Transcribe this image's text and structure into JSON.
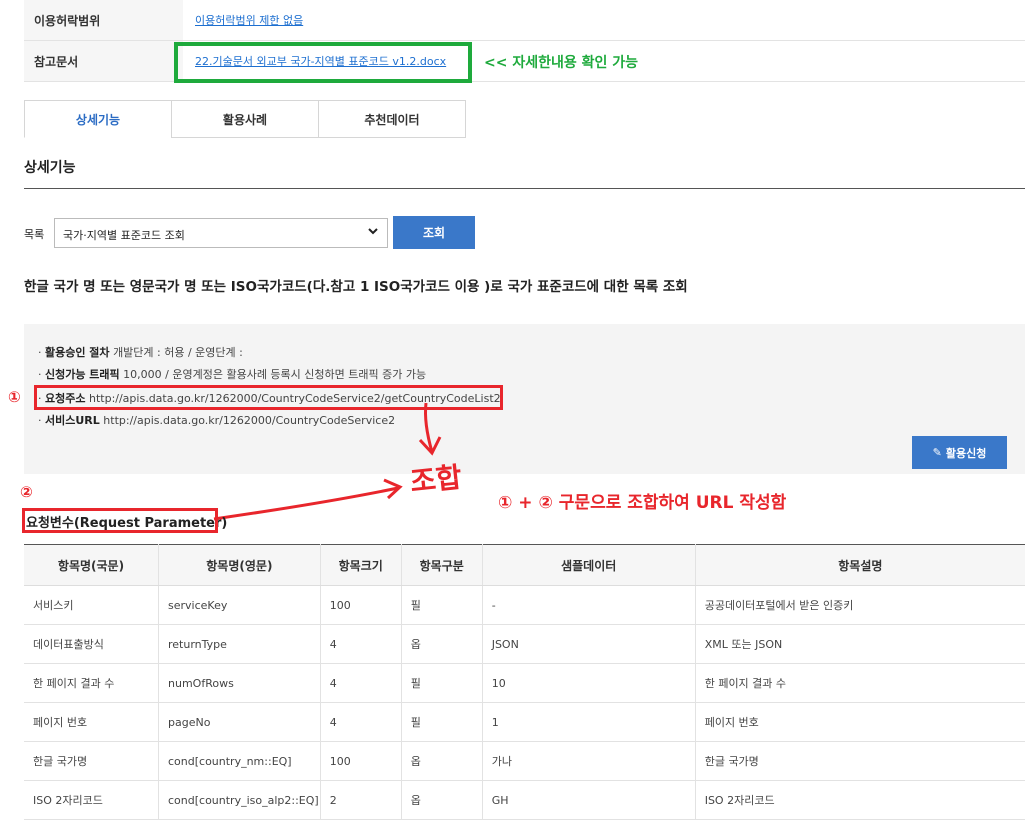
{
  "info": {
    "usage_scope_label": "이용허락범위",
    "usage_scope_value": "이용허락범위 제한 없음",
    "ref_doc_label": "참고문서",
    "ref_doc_value": "22.기술문서 외교부 국가-지역별 표준코드 v1.2.docx",
    "ref_doc_note": "<< 자세한내용 확인 가능"
  },
  "tabs": [
    {
      "label": "상세기능"
    },
    {
      "label": "활용사례"
    },
    {
      "label": "추천데이터"
    }
  ],
  "detail": {
    "title": "상세기능",
    "list_label": "목록",
    "select_value": "국가·지역별 표준코드 조회",
    "search_button": "조회",
    "description": "한글 국가 명 또는 영문국가 명 또는 ISO국가코드(다.참고 1 ISO국가코드 이용 )로 국가 표준코드에 대한 목록 조회"
  },
  "infobox": {
    "approval_label": "활용승인 절차",
    "approval_value": "개발단계 : 허용 / 운영단계 :",
    "traffic_label": "신청가능 트래픽",
    "traffic_value": "10,000 / 운영계정은 활용사례 등록시 신청하면 트래픽 증가 가능",
    "request_url_label": "요청주소",
    "request_url_value": "http://apis.data.go.kr/1262000/CountryCodeService2/getCountryCodeList2",
    "service_url_label": "서비스URL",
    "service_url_value": "http://apis.data.go.kr/1262000/CountryCodeService2",
    "apply_button": "활용신청"
  },
  "annotations": {
    "num1": "①",
    "num2": "②",
    "combine_handwritten": "조합",
    "combine_note": "① + ② 구문으로 조합하여 URL 작성함"
  },
  "params": {
    "title": "요청변수(Request Parameter)",
    "headers": [
      "항목명(국문)",
      "항목명(영문)",
      "항목크기",
      "항목구분",
      "샘플데이터",
      "항목설명"
    ],
    "rows": [
      [
        "서비스키",
        "serviceKey",
        "100",
        "필",
        "-",
        "공공데이터포털에서 받은 인증키"
      ],
      [
        "데이터표출방식",
        "returnType",
        "4",
        "옵",
        "JSON",
        "XML 또는 JSON"
      ],
      [
        "한 페이지 결과 수",
        "numOfRows",
        "4",
        "필",
        "10",
        "한 페이지 결과 수"
      ],
      [
        "페이지 번호",
        "pageNo",
        "4",
        "필",
        "1",
        "페이지 번호"
      ],
      [
        "한글 국가명",
        "cond[country_nm::EQ]",
        "100",
        "옵",
        "가나",
        "한글 국가명"
      ],
      [
        "ISO 2자리코드",
        "cond[country_iso_alp2::EQ]",
        "2",
        "옵",
        "GH",
        "ISO 2자리코드"
      ]
    ]
  },
  "colors": {
    "accent_blue": "#3a78c9",
    "annotation_red": "#e8262c",
    "annotation_green": "#1eaa3c"
  }
}
